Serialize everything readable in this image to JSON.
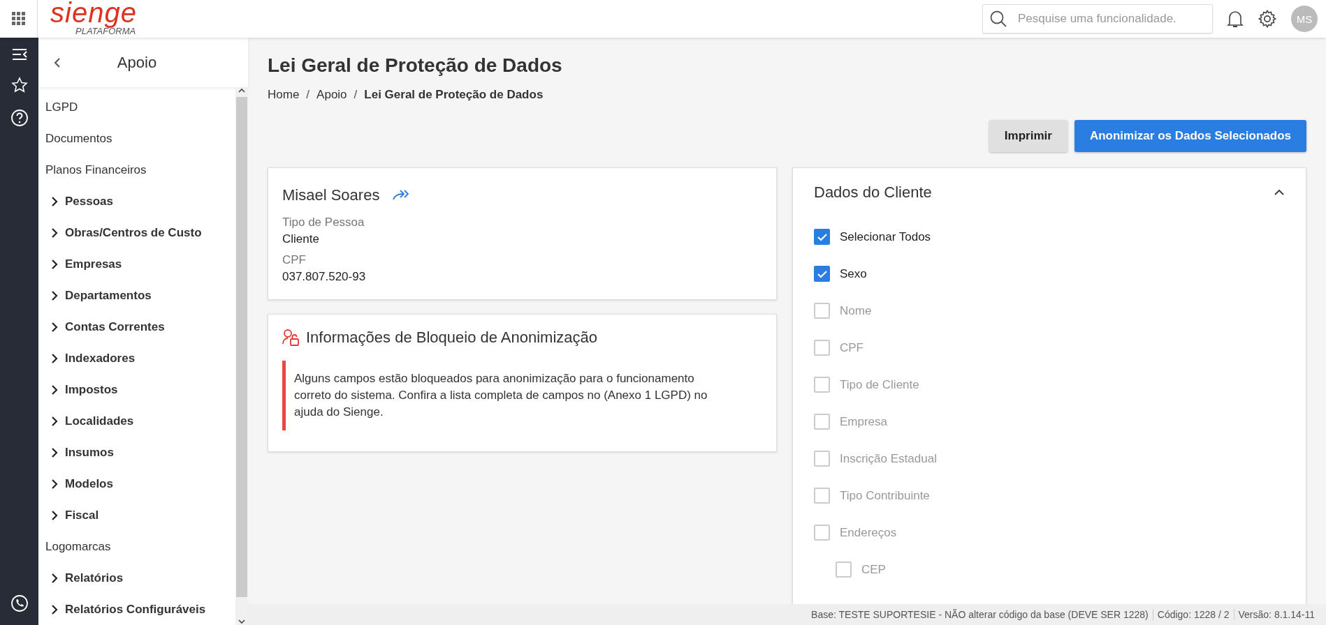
{
  "header": {
    "logo": "sienge",
    "logo_sub": "PLATAFORMA",
    "search": {
      "placeholder": "Pesquise uma funcionalidade."
    },
    "avatar": "MS"
  },
  "sidebar": {
    "title": "Apoio",
    "items": [
      {
        "label": "LGPD",
        "kind": "section"
      },
      {
        "label": "Documentos",
        "kind": "section"
      },
      {
        "label": "Planos Financeiros",
        "kind": "section"
      },
      {
        "label": "Pessoas",
        "kind": "group",
        "expanded": false
      },
      {
        "label": "Obras/Centros de Custo",
        "kind": "group",
        "expanded": false
      },
      {
        "label": "Empresas",
        "kind": "group",
        "expanded": false
      },
      {
        "label": "Departamentos",
        "kind": "group",
        "expanded": false
      },
      {
        "label": "Contas Correntes",
        "kind": "group",
        "expanded": false
      },
      {
        "label": "Indexadores",
        "kind": "group",
        "expanded": false
      },
      {
        "label": "Impostos",
        "kind": "group",
        "expanded": false
      },
      {
        "label": "Localidades",
        "kind": "group",
        "expanded": false
      },
      {
        "label": "Insumos",
        "kind": "group",
        "expanded": false
      },
      {
        "label": "Modelos",
        "kind": "group",
        "expanded": false
      },
      {
        "label": "Fiscal",
        "kind": "group",
        "expanded": false
      },
      {
        "label": "Logomarcas",
        "kind": "section"
      },
      {
        "label": "Relatórios",
        "kind": "group",
        "expanded": false
      },
      {
        "label": "Relatórios Configuráveis",
        "kind": "group",
        "expanded": false
      }
    ]
  },
  "page": {
    "title": "Lei Geral de Proteção de Dados",
    "breadcrumb": [
      "Home",
      "Apoio",
      "Lei Geral de Proteção de Dados"
    ],
    "breadcrumb_separator": "/",
    "buttons": [
      {
        "label": "Imprimir",
        "kind": "secondary"
      },
      {
        "label": "Anonimizar os Dados Selecionados",
        "kind": "primary"
      }
    ]
  },
  "person": {
    "name": "Misael Soares",
    "fields": [
      {
        "label": "Tipo de Pessoa",
        "value": "Cliente"
      },
      {
        "label": "CPF",
        "value": "037.807.520-93"
      }
    ]
  },
  "block_info": {
    "title": "Informações de Bloqueio de Anonimização",
    "message": "Alguns campos estão bloqueados para anonimização para o funcionamento correto do sistema. Confira a lista completa de campos no (Anexo 1 LGPD) no ajuda do Sienge."
  },
  "client_data": {
    "title": "Dados do Cliente",
    "expanded": true,
    "options": [
      {
        "label": "Selecionar Todos",
        "checked": true,
        "disabled": false
      },
      {
        "label": "Sexo",
        "checked": true,
        "disabled": false
      },
      {
        "label": "Nome",
        "checked": false,
        "disabled": true
      },
      {
        "label": "CPF",
        "checked": false,
        "disabled": true
      },
      {
        "label": "Tipo de Cliente",
        "checked": false,
        "disabled": true
      },
      {
        "label": "Empresa",
        "checked": false,
        "disabled": true
      },
      {
        "label": "Inscrição Estadual",
        "checked": false,
        "disabled": true
      },
      {
        "label": "Tipo Contribuinte",
        "checked": false,
        "disabled": true
      },
      {
        "label": "Endereços",
        "checked": false,
        "disabled": true,
        "children": [
          {
            "label": "CEP",
            "checked": false,
            "disabled": true
          }
        ]
      }
    ]
  },
  "status_bar": [
    "Base: TESTE SUPORTESIE - NÃO alterar código da base (DEVE SER 1228)",
    "Código: 1228 / 2",
    "Versão: 8.1.14-11"
  ]
}
